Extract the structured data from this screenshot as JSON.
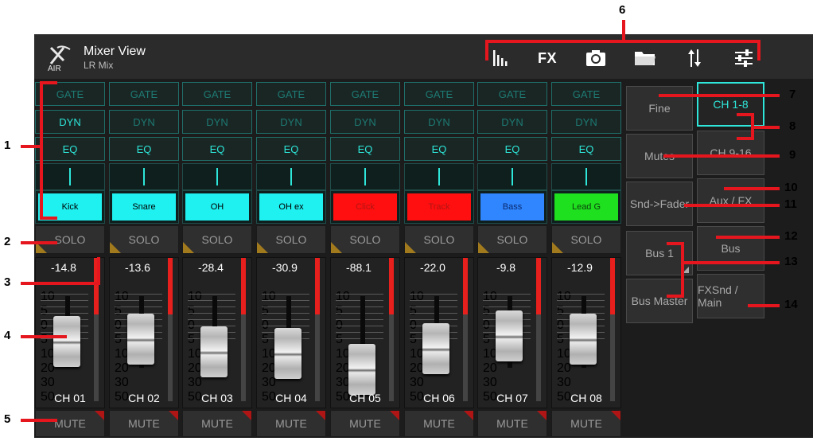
{
  "header": {
    "title": "Mixer View",
    "subtitle": "LR Mix",
    "logo_text": "AIR"
  },
  "toolbar": {
    "icons": [
      "meter-bars-icon",
      "fx-icon",
      "camera-icon",
      "folder-icon",
      "transfer-arrows-icon",
      "sliders-icon"
    ],
    "fx_label": "FX"
  },
  "strip_buttons": {
    "gate": "GATE",
    "dyn": "DYN",
    "eq": "EQ"
  },
  "channels": [
    {
      "name": "Kick",
      "color": "#1ff0f0",
      "text_color": "#000000",
      "value": "-14.8",
      "ch": "CH 01",
      "dyn_on": true,
      "level": 0.58
    },
    {
      "name": "Snare",
      "color": "#1ff0f0",
      "text_color": "#000000",
      "value": "-13.6",
      "ch": "CH 02",
      "dyn_on": false,
      "level": 0.63
    },
    {
      "name": "OH",
      "color": "#1ff0f0",
      "text_color": "#000000",
      "value": "-28.4",
      "ch": "CH 03",
      "dyn_on": false,
      "level": 0.36
    },
    {
      "name": "OH ex",
      "color": "#1ff0f0",
      "text_color": "#000000",
      "value": "-30.9",
      "ch": "CH 04",
      "dyn_on": false,
      "level": 0.34
    },
    {
      "name": "Click",
      "color": "#ff0f0f",
      "text_color": "#b31414",
      "value": "-88.1",
      "ch": "CH 05",
      "dyn_on": false,
      "level": 0.0
    },
    {
      "name": "Track",
      "color": "#ff0f0f",
      "text_color": "#b31414",
      "value": "-22.0",
      "ch": "CH 06",
      "dyn_on": false,
      "level": 0.43
    },
    {
      "name": "Bass",
      "color": "#2f86ff",
      "text_color": "#0b2a6e",
      "value": "-9.8",
      "ch": "CH 07",
      "dyn_on": false,
      "level": 0.7
    },
    {
      "name": "Lead G",
      "color": "#1fe01f",
      "text_color": "#0b3d0b",
      "value": "-12.9",
      "ch": "CH 08",
      "dyn_on": false,
      "level": 0.64
    }
  ],
  "fader_scale": [
    "10",
    "5",
    "0",
    "5",
    "10",
    "20",
    "30",
    "50"
  ],
  "solo_label": "SOLO",
  "mute_label": "MUTE",
  "right_panel": {
    "fine": "Fine",
    "mutes": "Mutes",
    "snd_fader": "Snd->Fader",
    "bus1": "Bus 1",
    "bus_master": "Bus Master",
    "ch1_8": "CH 1-8",
    "ch9_16": "CH 9-16",
    "aux_fx": "Aux / FX",
    "bus": "Bus",
    "fxsnd_main": "FXSnd / Main"
  },
  "callouts": [
    "1",
    "2",
    "3",
    "4",
    "5",
    "6",
    "7",
    "8",
    "9",
    "10",
    "11",
    "12",
    "13",
    "14"
  ],
  "colors": {
    "accent": "#2ee6d9",
    "annotation": "#e5161d",
    "meter": "#e8201d"
  }
}
